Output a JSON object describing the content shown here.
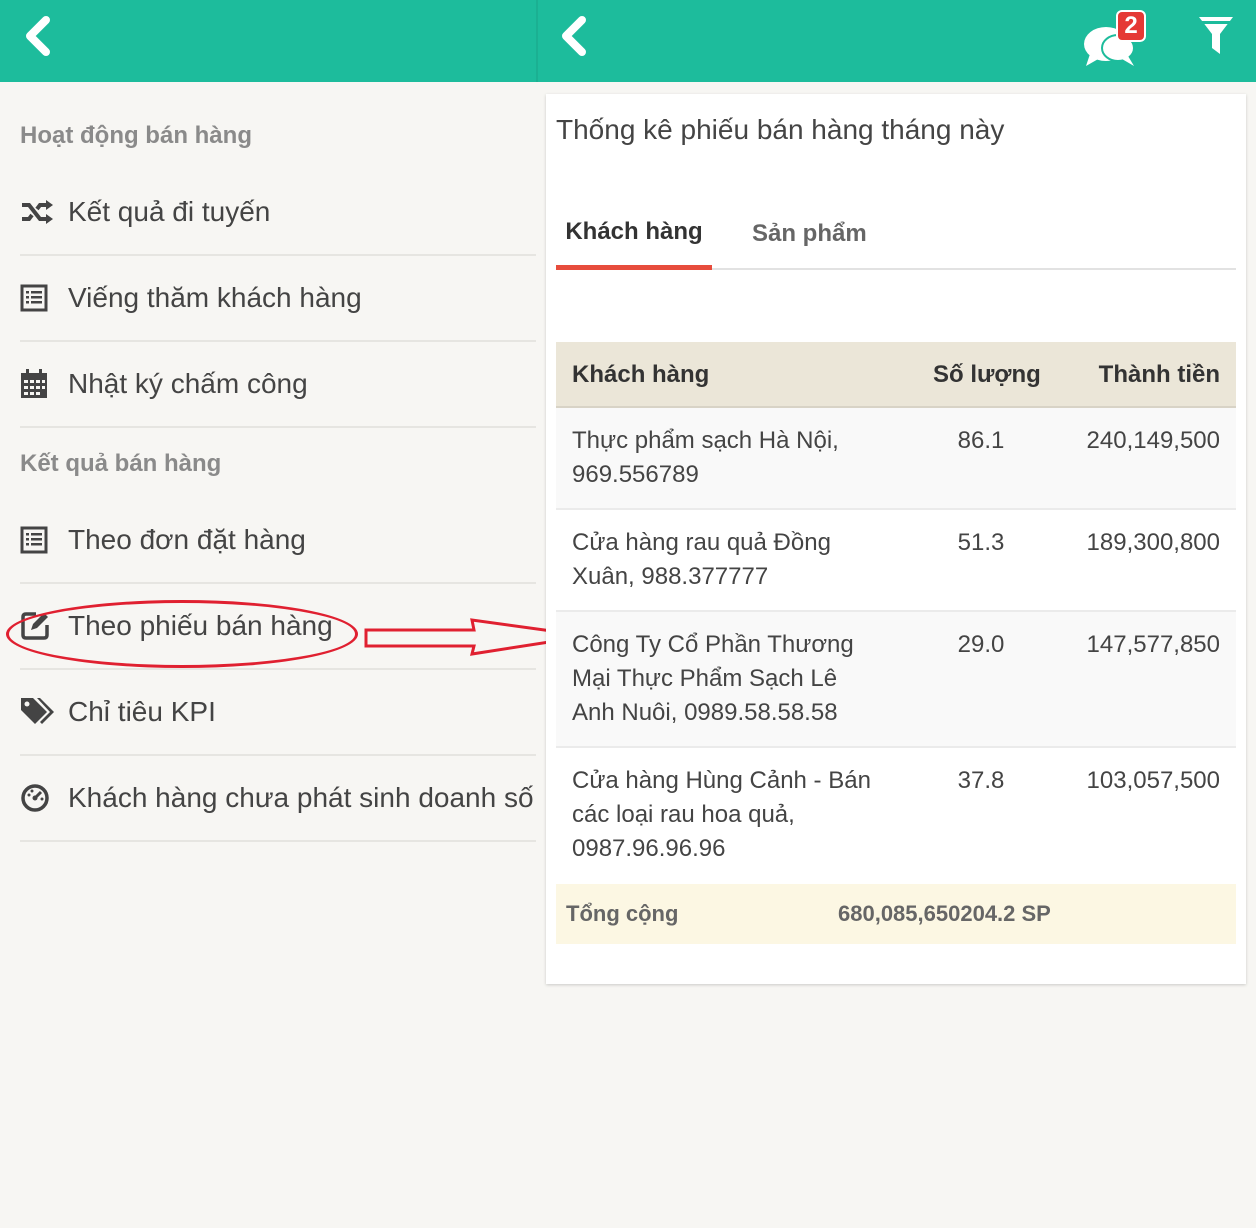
{
  "header": {
    "notification_count": "2",
    "color": "#1dbc9c"
  },
  "sidebar": {
    "section1_title": "Hoạt động bán hàng",
    "section2_title": "Kết quả bán hàng",
    "items": [
      {
        "label": "Kết quả đi tuyến",
        "icon": "shuffle-icon"
      },
      {
        "label": "Viếng thăm khách hàng",
        "icon": "list-icon"
      },
      {
        "label": "Nhật ký chấm công",
        "icon": "calendar-icon"
      },
      {
        "label": "Theo đơn đặt hàng",
        "icon": "list-icon"
      },
      {
        "label": "Theo phiếu bán hàng",
        "icon": "edit-icon"
      },
      {
        "label": "Chỉ tiêu KPI",
        "icon": "tags-icon"
      },
      {
        "label": "Khách hàng chưa phát sinh doanh số",
        "icon": "dashboard-icon"
      }
    ]
  },
  "panel": {
    "title": "Thống kê phiếu bán hàng tháng này",
    "tabs": [
      "Khách hàng",
      "Sản phẩm"
    ],
    "active_tab": "Khách hàng",
    "table": {
      "headers": [
        "Khách hàng",
        "Số lượng",
        "Thành tiền"
      ],
      "rows": [
        {
          "name": "Thực phẩm sạch Hà Nội, 969.556789",
          "qty": "86.1",
          "amount": "240,149,500"
        },
        {
          "name": "Cửa hàng rau quả Đồng Xuân, 988.377777",
          "qty": "51.3",
          "amount": "189,300,800"
        },
        {
          "name": "Công Ty Cổ Phần Thương Mại Thực Phẩm Sạch Lê Anh Nuôi, 0989.58.58.58",
          "qty": "29.0",
          "amount": "147,577,850"
        },
        {
          "name": "Cửa hàng Hùng Cảnh - Bán các loại rau hoa quả, 0987.96.96.96",
          "qty": "37.8",
          "amount": "103,057,500"
        }
      ],
      "total_label": "Tổng cộng",
      "total_value": "680,085,650204.2 SP"
    }
  },
  "colors": {
    "accent": "#1dbc9c",
    "tab_underline": "#e74c3c",
    "annotation": "#e02030",
    "badge": "#e53935"
  }
}
